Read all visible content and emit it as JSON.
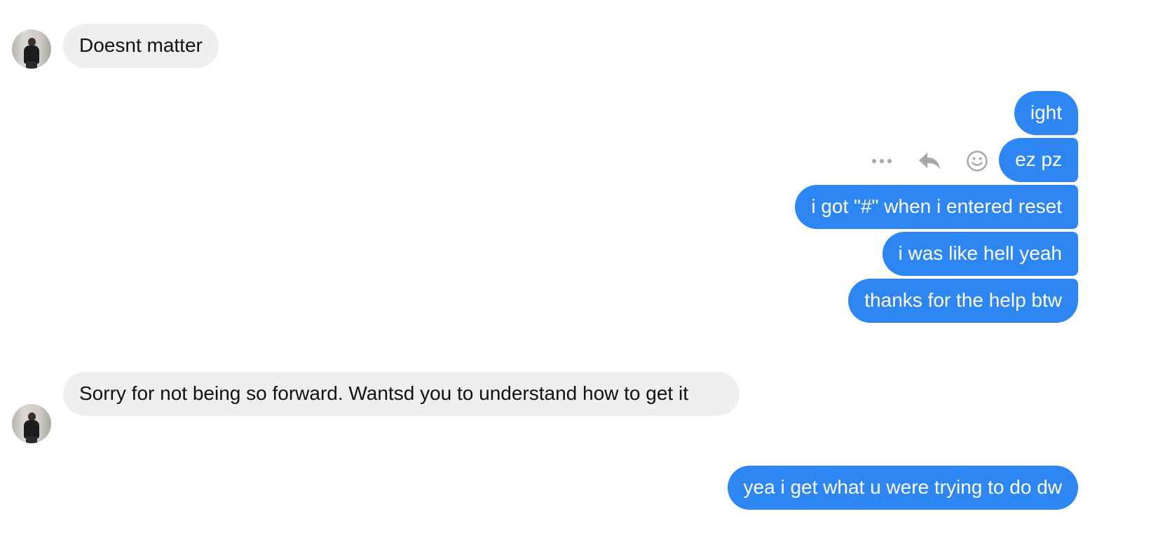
{
  "messages": [
    {
      "sender": "other",
      "text": "Doesnt matter"
    },
    {
      "sender": "me",
      "text": "ight"
    },
    {
      "sender": "me",
      "text": "ez pz"
    },
    {
      "sender": "me",
      "text": "i got \"#\" when i entered reset"
    },
    {
      "sender": "me",
      "text": "i was like hell yeah"
    },
    {
      "sender": "me",
      "text": "thanks for the help btw"
    },
    {
      "sender": "other",
      "text": "Sorry for not being so forward. Wantsd you to understand how to get it"
    },
    {
      "sender": "me",
      "text": "yea i get what u were trying to do dw"
    }
  ],
  "message_actions": {
    "icons": [
      "more-icon",
      "reply-icon",
      "reaction-icon"
    ]
  },
  "colors": {
    "outgoing_bubble": "#2e86f2",
    "incoming_bubble": "#efefef",
    "icon_gray": "#a8a8a8"
  }
}
